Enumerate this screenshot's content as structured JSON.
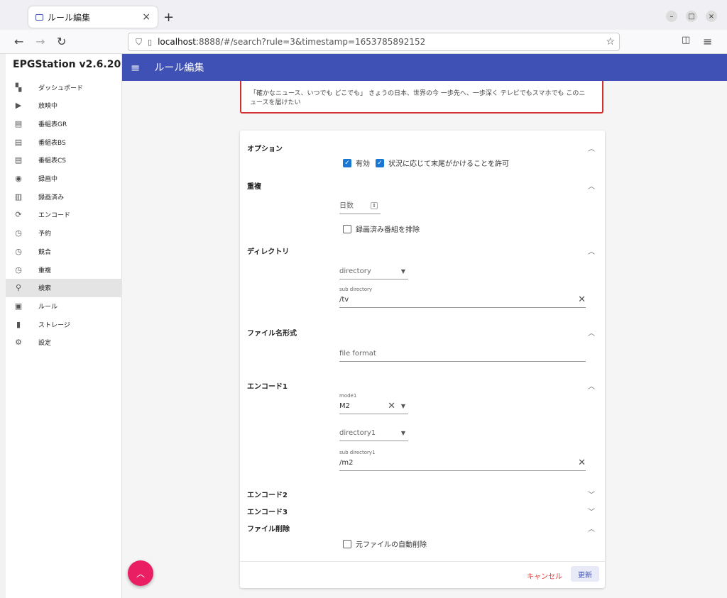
{
  "browser": {
    "tab_title": "ルール編集",
    "url_host": "localhost",
    "url_rest": ":8888/#/search?rule=3&timestamp=1653785892152"
  },
  "sidebar": {
    "app_title": "EPGStation v2.6.20",
    "items": [
      {
        "label": "ダッシュボード",
        "icon": "dashboard-icon",
        "glyph": "▚"
      },
      {
        "label": "放映中",
        "icon": "live-tv-icon",
        "glyph": "▶"
      },
      {
        "label": "番組表GR",
        "icon": "program-guide-icon",
        "glyph": "▤"
      },
      {
        "label": "番組表BS",
        "icon": "program-guide-icon",
        "glyph": "▤"
      },
      {
        "label": "番組表CS",
        "icon": "program-guide-icon",
        "glyph": "▤"
      },
      {
        "label": "録画中",
        "icon": "record-icon",
        "glyph": "◉"
      },
      {
        "label": "録画済み",
        "icon": "video-library-icon",
        "glyph": "▥"
      },
      {
        "label": "エンコード",
        "icon": "sync-icon",
        "glyph": "⟳"
      },
      {
        "label": "予約",
        "icon": "clock-icon",
        "glyph": "◷"
      },
      {
        "label": "競合",
        "icon": "clock-icon",
        "glyph": "◷"
      },
      {
        "label": "重複",
        "icon": "clock-icon",
        "glyph": "◷"
      },
      {
        "label": "検索",
        "icon": "search-icon",
        "glyph": "⚲"
      },
      {
        "label": "ルール",
        "icon": "calendar-icon",
        "glyph": "▣"
      },
      {
        "label": "ストレージ",
        "icon": "sd-card-icon",
        "glyph": "▮"
      },
      {
        "label": "設定",
        "icon": "gear-icon",
        "glyph": "⚙"
      }
    ],
    "active_index": 11
  },
  "appbar": {
    "title": "ルール編集"
  },
  "description": {
    "text": "「確かなニュース、いつでも どこでも」 きょうの日本、世界の今 一歩先へ、一歩深く テレビでもスマホでも このニュースを届けたい"
  },
  "sections": {
    "option": {
      "title": "オプション",
      "enabled_label": "有効",
      "allow_end_cut_label": "状況に応じて末尾がかけることを許可"
    },
    "duplicate": {
      "title": "重複",
      "days_placeholder": "日数",
      "exclude_recorded_label": "録画済み番組を排除"
    },
    "directory": {
      "title": "ディレクトリ",
      "directory_placeholder": "directory",
      "sub_directory_label": "sub directory",
      "sub_directory_value": "/tv"
    },
    "filename": {
      "title": "ファイル名形式",
      "file_format_placeholder": "file format"
    },
    "encode1": {
      "title": "エンコード1",
      "mode_label": "mode1",
      "mode_value": "M2",
      "directory_placeholder": "directory1",
      "sub_directory_label": "sub directory1",
      "sub_directory_value": "/m2"
    },
    "encode2": {
      "title": "エンコード2"
    },
    "encode3": {
      "title": "エンコード3"
    },
    "delete": {
      "title": "ファイル削除",
      "auto_delete_label": "元ファイルの自動削除"
    }
  },
  "footer": {
    "cancel_label": "キャンセル",
    "update_label": "更新"
  }
}
